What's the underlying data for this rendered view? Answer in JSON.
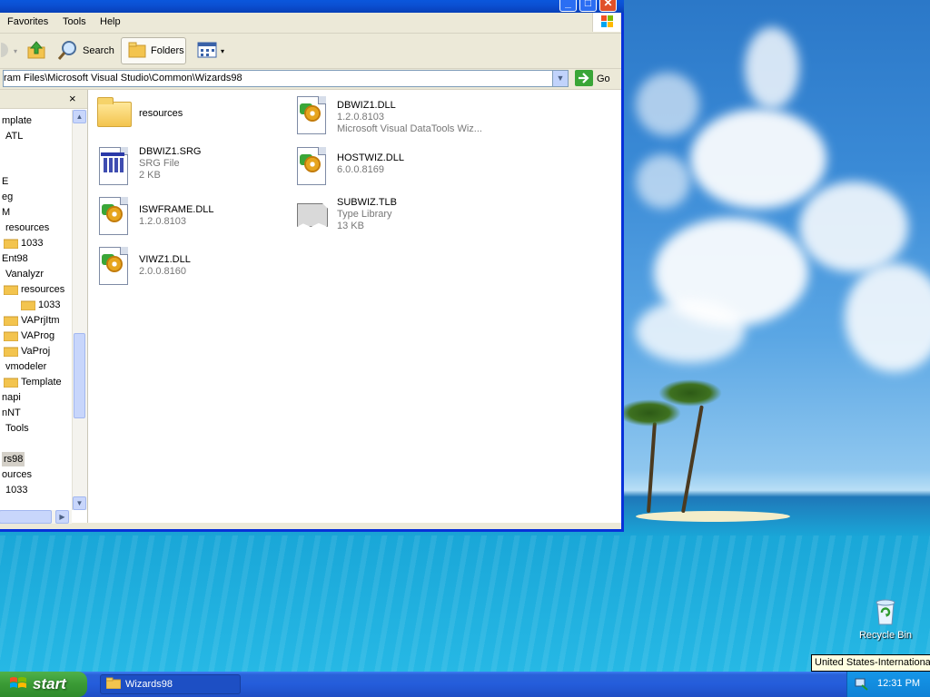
{
  "window": {
    "menu": [
      "Favorites",
      "Tools",
      "Help"
    ],
    "toolbar": {
      "search_label": "Search",
      "folders_label": "Folders"
    },
    "address": {
      "value": "ram Files\\Microsoft Visual Studio\\Common\\Wizards98",
      "go_label": "Go"
    },
    "tree": [
      "mplate",
      "ATL",
      "E",
      "eg",
      "M",
      "resources",
      "1033",
      "Ent98",
      "Vanalyzr",
      "resources",
      "1033",
      "VAPrjItm",
      "VAProg",
      "VaProj",
      "vmodeler",
      "Template",
      "napi",
      "nNT",
      "Tools",
      "rs98",
      "ources",
      "1033"
    ],
    "files": [
      {
        "name": "resources",
        "line1": "",
        "line2": "",
        "icon": "folder-icon"
      },
      {
        "name": "DBWIZ1.DLL",
        "line1": "1.2.0.8103",
        "line2": "Microsoft Visual DataTools Wiz...",
        "icon": "dll-icon"
      },
      {
        "name": "DBWIZ1.SRG",
        "line1": "SRG File",
        "line2": "2 KB",
        "icon": "srg-file-icon"
      },
      {
        "name": "HOSTWIZ.DLL",
        "line1": "6.0.0.8169",
        "line2": "",
        "icon": "dll-icon"
      },
      {
        "name": "ISWFRAME.DLL",
        "line1": "1.2.0.8103",
        "line2": "",
        "icon": "dll-icon"
      },
      {
        "name": "SUBWIZ.TLB",
        "line1": "Type Library",
        "line2": "13 KB",
        "icon": "type-library-icon"
      },
      {
        "name": "VIWZ1.DLL",
        "line1": "2.0.0.8160",
        "line2": "",
        "icon": "dll-icon"
      }
    ]
  },
  "desktop": {
    "recycle_bin_label": "Recycle Bin",
    "tooltip": "United States-International"
  },
  "taskbar": {
    "start_label": "start",
    "task_label": "Wizards98",
    "clock": "12:31 PM"
  }
}
